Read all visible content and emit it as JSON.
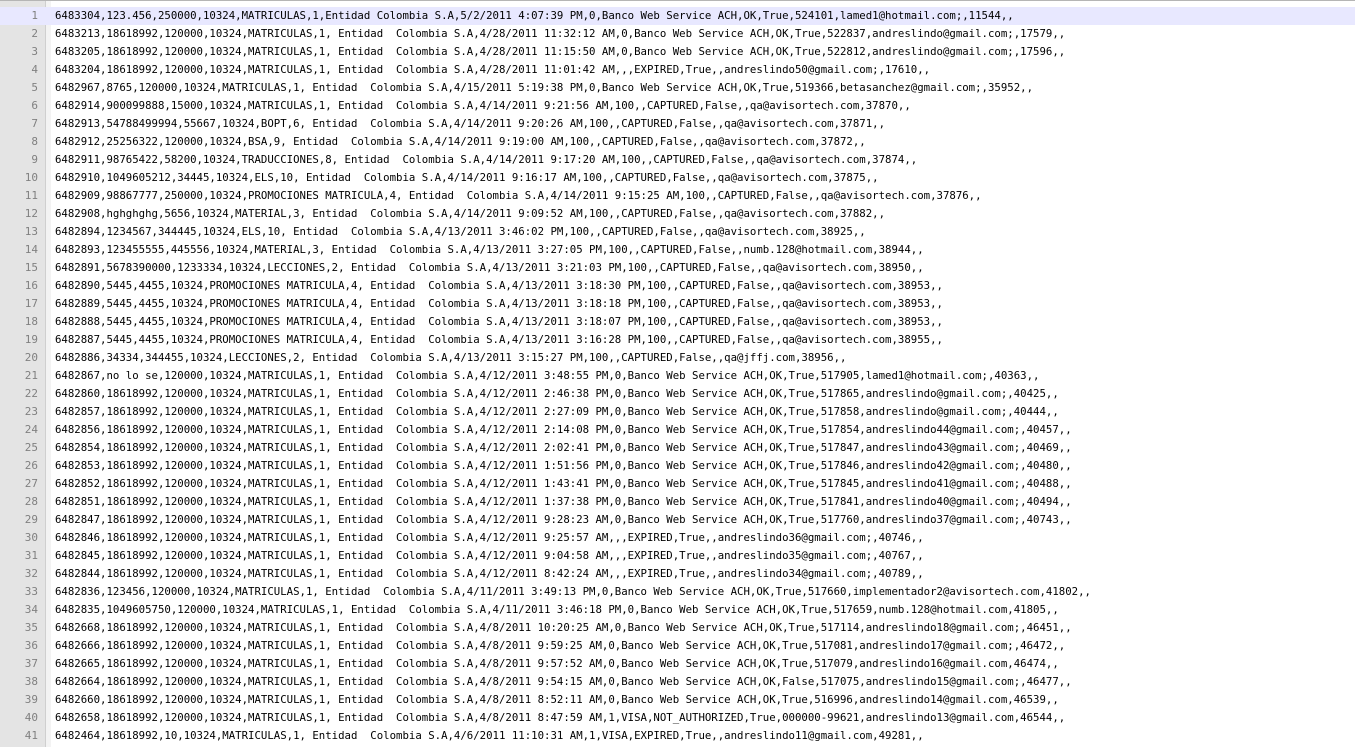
{
  "editor": {
    "current_line": 1,
    "lines": [
      "6483304,123.456,250000,10324,MATRICULAS,1,Entidad Colombia S.A,5/2/2011 4:07:39 PM,0,Banco Web Service ACH,OK,True,524101,lamed1@hotmail.com;,11544,,",
      "6483213,18618992,120000,10324,MATRICULAS,1, Entidad  Colombia S.A,4/28/2011 11:32:12 AM,0,Banco Web Service ACH,OK,True,522837,andreslindo@gmail.com;,17579,,",
      "6483205,18618992,120000,10324,MATRICULAS,1, Entidad  Colombia S.A,4/28/2011 11:15:50 AM,0,Banco Web Service ACH,OK,True,522812,andreslindo@gmail.com;,17596,,",
      "6483204,18618992,120000,10324,MATRICULAS,1, Entidad  Colombia S.A,4/28/2011 11:01:42 AM,,,EXPIRED,True,,andreslindo50@gmail.com;,17610,,",
      "6482967,8765,120000,10324,MATRICULAS,1, Entidad  Colombia S.A,4/15/2011 5:19:38 PM,0,Banco Web Service ACH,OK,True,519366,betasanchez@gmail.com;,35952,,",
      "6482914,900099888,15000,10324,MATRICULAS,1, Entidad  Colombia S.A,4/14/2011 9:21:56 AM,100,,CAPTURED,False,,qa@avisortech.com,37870,,",
      "6482913,54788499994,55667,10324,BOPT,6, Entidad  Colombia S.A,4/14/2011 9:20:26 AM,100,,CAPTURED,False,,qa@avisortech.com,37871,,",
      "6482912,25256322,120000,10324,BSA,9, Entidad  Colombia S.A,4/14/2011 9:19:00 AM,100,,CAPTURED,False,,qa@avisortech.com,37872,,",
      "6482911,98765422,58200,10324,TRADUCCIONES,8, Entidad  Colombia S.A,4/14/2011 9:17:20 AM,100,,CAPTURED,False,,qa@avisortech.com,37874,,",
      "6482910,1049605212,34445,10324,ELS,10, Entidad  Colombia S.A,4/14/2011 9:16:17 AM,100,,CAPTURED,False,,qa@avisortech.com,37875,,",
      "6482909,98867777,250000,10324,PROMOCIONES MATRICULA,4, Entidad  Colombia S.A,4/14/2011 9:15:25 AM,100,,CAPTURED,False,,qa@avisortech.com,37876,,",
      "6482908,hghghghg,5656,10324,MATERIAL,3, Entidad  Colombia S.A,4/14/2011 9:09:52 AM,100,,CAPTURED,False,,qa@avisortech.com,37882,,",
      "6482894,1234567,344445,10324,ELS,10, Entidad  Colombia S.A,4/13/2011 3:46:02 PM,100,,CAPTURED,False,,qa@avisortech.com,38925,,",
      "6482893,123455555,445556,10324,MATERIAL,3, Entidad  Colombia S.A,4/13/2011 3:27:05 PM,100,,CAPTURED,False,,numb.128@hotmail.com,38944,,",
      "6482891,5678390000,1233334,10324,LECCIONES,2, Entidad  Colombia S.A,4/13/2011 3:21:03 PM,100,,CAPTURED,False,,qa@avisortech.com,38950,,",
      "6482890,5445,4455,10324,PROMOCIONES MATRICULA,4, Entidad  Colombia S.A,4/13/2011 3:18:30 PM,100,,CAPTURED,False,,qa@avisortech.com,38953,,",
      "6482889,5445,4455,10324,PROMOCIONES MATRICULA,4, Entidad  Colombia S.A,4/13/2011 3:18:18 PM,100,,CAPTURED,False,,qa@avisortech.com,38953,,",
      "6482888,5445,4455,10324,PROMOCIONES MATRICULA,4, Entidad  Colombia S.A,4/13/2011 3:18:07 PM,100,,CAPTURED,False,,qa@avisortech.com,38953,,",
      "6482887,5445,4455,10324,PROMOCIONES MATRICULA,4, Entidad  Colombia S.A,4/13/2011 3:16:28 PM,100,,CAPTURED,False,,qa@avisortech.com,38955,,",
      "6482886,34334,344455,10324,LECCIONES,2, Entidad  Colombia S.A,4/13/2011 3:15:27 PM,100,,CAPTURED,False,,qa@jffj.com,38956,,",
      "6482867,no lo se,120000,10324,MATRICULAS,1, Entidad  Colombia S.A,4/12/2011 3:48:55 PM,0,Banco Web Service ACH,OK,True,517905,lamed1@hotmail.com;,40363,,",
      "6482860,18618992,120000,10324,MATRICULAS,1, Entidad  Colombia S.A,4/12/2011 2:46:38 PM,0,Banco Web Service ACH,OK,True,517865,andreslindo@gmail.com;,40425,,",
      "6482857,18618992,120000,10324,MATRICULAS,1, Entidad  Colombia S.A,4/12/2011 2:27:09 PM,0,Banco Web Service ACH,OK,True,517858,andreslindo@gmail.com;,40444,,",
      "6482856,18618992,120000,10324,MATRICULAS,1, Entidad  Colombia S.A,4/12/2011 2:14:08 PM,0,Banco Web Service ACH,OK,True,517854,andreslindo44@gmail.com;,40457,,",
      "6482854,18618992,120000,10324,MATRICULAS,1, Entidad  Colombia S.A,4/12/2011 2:02:41 PM,0,Banco Web Service ACH,OK,True,517847,andreslindo43@gmail.com;,40469,,",
      "6482853,18618992,120000,10324,MATRICULAS,1, Entidad  Colombia S.A,4/12/2011 1:51:56 PM,0,Banco Web Service ACH,OK,True,517846,andreslindo42@gmail.com;,40480,,",
      "6482852,18618992,120000,10324,MATRICULAS,1, Entidad  Colombia S.A,4/12/2011 1:43:41 PM,0,Banco Web Service ACH,OK,True,517845,andreslindo41@gmail.com;,40488,,",
      "6482851,18618992,120000,10324,MATRICULAS,1, Entidad  Colombia S.A,4/12/2011 1:37:38 PM,0,Banco Web Service ACH,OK,True,517841,andreslindo40@gmail.com;,40494,,",
      "6482847,18618992,120000,10324,MATRICULAS,1, Entidad  Colombia S.A,4/12/2011 9:28:23 AM,0,Banco Web Service ACH,OK,True,517760,andreslindo37@gmail.com;,40743,,",
      "6482846,18618992,120000,10324,MATRICULAS,1, Entidad  Colombia S.A,4/12/2011 9:25:57 AM,,,EXPIRED,True,,andreslindo36@gmail.com;,40746,,",
      "6482845,18618992,120000,10324,MATRICULAS,1, Entidad  Colombia S.A,4/12/2011 9:04:58 AM,,,EXPIRED,True,,andreslindo35@gmail.com;,40767,,",
      "6482844,18618992,120000,10324,MATRICULAS,1, Entidad  Colombia S.A,4/12/2011 8:42:24 AM,,,EXPIRED,True,,andreslindo34@gmail.com;,40789,,",
      "6482836,123456,120000,10324,MATRICULAS,1, Entidad  Colombia S.A,4/11/2011 3:49:13 PM,0,Banco Web Service ACH,OK,True,517660,implementador2@avisortech.com,41802,,",
      "6482835,1049605750,120000,10324,MATRICULAS,1, Entidad  Colombia S.A,4/11/2011 3:46:18 PM,0,Banco Web Service ACH,OK,True,517659,numb.128@hotmail.com,41805,,",
      "6482668,18618992,120000,10324,MATRICULAS,1, Entidad  Colombia S.A,4/8/2011 10:20:25 AM,0,Banco Web Service ACH,OK,True,517114,andreslindo18@gmail.com;,46451,,",
      "6482666,18618992,120000,10324,MATRICULAS,1, Entidad  Colombia S.A,4/8/2011 9:59:25 AM,0,Banco Web Service ACH,OK,True,517081,andreslindo17@gmail.com;,46472,,",
      "6482665,18618992,120000,10324,MATRICULAS,1, Entidad  Colombia S.A,4/8/2011 9:57:52 AM,0,Banco Web Service ACH,OK,True,517079,andreslindo16@gmail.com,46474,,",
      "6482664,18618992,120000,10324,MATRICULAS,1, Entidad  Colombia S.A,4/8/2011 9:54:15 AM,0,Banco Web Service ACH,OK,False,517075,andreslindo15@gmail.com;,46477,,",
      "6482660,18618992,120000,10324,MATRICULAS,1, Entidad  Colombia S.A,4/8/2011 8:52:11 AM,0,Banco Web Service ACH,OK,True,516996,andreslindo14@gmail.com,46539,,",
      "6482658,18618992,120000,10324,MATRICULAS,1, Entidad  Colombia S.A,4/8/2011 8:47:59 AM,1,VISA,NOT_AUTHORIZED,True,000000-99621,andreslindo13@gmail.com,46544,,",
      "6482464,18618992,10,10324,MATRICULAS,1, Entidad  Colombia S.A,4/6/2011 11:10:31 AM,1,VISA,EXPIRED,True,,andreslindo11@gmail.com,49281,,"
    ]
  }
}
